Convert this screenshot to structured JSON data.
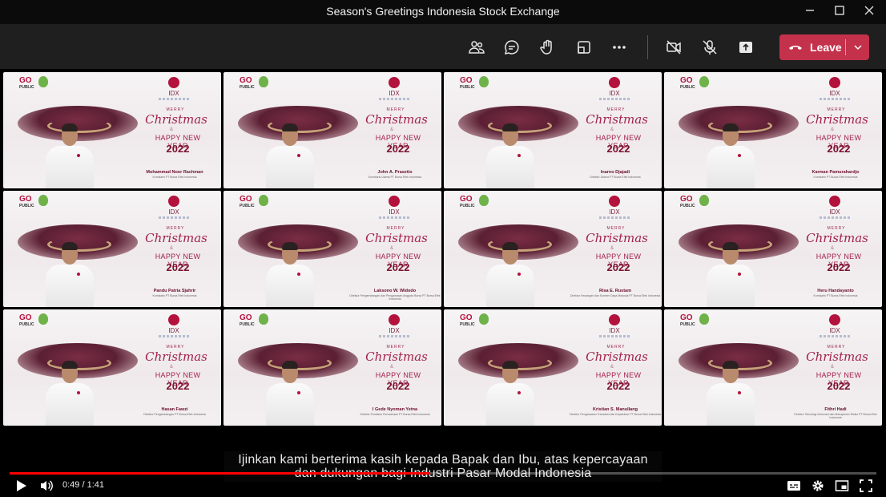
{
  "window": {
    "title": "Season's Greetings Indonesia Stock Exchange"
  },
  "toolbar": {
    "leave_label": "Leave",
    "leave_color": "#c4314b"
  },
  "card": {
    "merry": "MERRY",
    "christmas": "Christmas",
    "amp": "&",
    "happy_new_year": "HAPPY NEW YEAR",
    "year": "2022",
    "idx": "IDX",
    "go": "GO",
    "go_sub": "PUBLIC"
  },
  "participants": [
    {
      "name": "Mohammad Noor Rachman",
      "title": "Komisaris PT Bursa Efek Indonesia"
    },
    {
      "name": "John A. Prasetio",
      "title": "Komisaris Utama PT Bursa Efek Indonesia"
    },
    {
      "name": "Inarno Djajadi",
      "title": "Direktur Utama PT Bursa Efek Indonesia"
    },
    {
      "name": "Karman Pamurahardjo",
      "title": "Komisaris PT Bursa Efek Indonesia"
    },
    {
      "name": "Pandu Patria Sjahrir",
      "title": "Komisaris PT Bursa Efek Indonesia"
    },
    {
      "name": "Laksono W. Widodo",
      "title": "Direktur Pengembangan dan Pengawasan Anggota Bursa PT Bursa Efek Indonesia"
    },
    {
      "name": "Risa E. Rustam",
      "title": "Direktur Keuangan dan Sumber Daya Manusia PT Bursa Efek Indonesia"
    },
    {
      "name": "Heru Handayanto",
      "title": "Komisaris PT Bursa Efek Indonesia"
    },
    {
      "name": "Hasan Fawzi",
      "title": "Direktur Pengembangan PT Bursa Efek Indonesia"
    },
    {
      "name": "I Gede Nyoman Yetna",
      "title": "Direktur Penilaian Perusahaan PT Bursa Efek Indonesia"
    },
    {
      "name": "Kristian S. Manullang",
      "title": "Direktur Pengawasan Transaksi dan Kepatuhan PT Bursa Efek Indonesia"
    },
    {
      "name": "Fithri Hadi",
      "title": "Direktur Teknologi Informasi dan Manajemen Risiko PT Bursa Efek Indonesia"
    }
  ],
  "subtitles": {
    "line1": "Ijinkan kami berterima kasih kepada Bapak dan Ibu, atas kepercayaan",
    "line2": "dan dukungan bagi Industri Pasar Modal Indonesia"
  },
  "player": {
    "time": "0:49 / 1:41",
    "progress": 0.485
  },
  "icons": {
    "window": [
      "minimize-icon",
      "maximize-icon",
      "close-icon"
    ],
    "toolbar": [
      "people-icon",
      "chat-icon",
      "raise-hand-icon",
      "view-icon",
      "more-icon",
      "camera-off-icon",
      "mic-off-icon",
      "share-icon"
    ],
    "player": [
      "play-icon",
      "volume-icon",
      "captions-icon",
      "settings-icon",
      "miniplayer-icon",
      "fullscreen-icon"
    ]
  }
}
